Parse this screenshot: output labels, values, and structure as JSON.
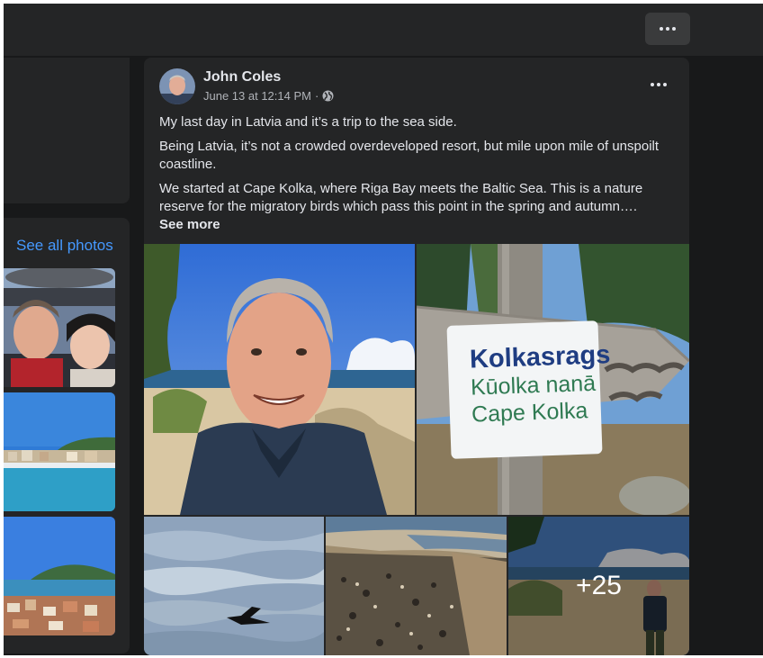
{
  "left_column": {
    "see_all_photos": "See all photos"
  },
  "post": {
    "author": "John Coles",
    "timestamp": "June 13 at 12:14 PM",
    "separator": "·",
    "paragraphs": [
      "My last day in Latvia and it’s a trip to the sea side.",
      "Being Latvia, it’s not a crowded overdeveloped resort, but mile upon mile of unspoilt coastline.",
      "We started at Cape Kolka, where Riga Bay meets the Baltic Sea. This is a nature reserve for the migratory birds which pass this point in the spring and autumn…."
    ],
    "see_more": "See more",
    "sign": {
      "line1": "Kolkasrags",
      "line2": "Kūolka nanā",
      "line3": "Cape Kolka"
    },
    "more_photos_count": "+25"
  },
  "colors": {
    "page_bg": "#18191a",
    "card_bg": "#242526",
    "link": "#4599ff",
    "text_primary": "#e4e6eb",
    "text_secondary": "#b0b3b8"
  },
  "icons": [
    "more-horizontal-icon",
    "globe-icon"
  ]
}
